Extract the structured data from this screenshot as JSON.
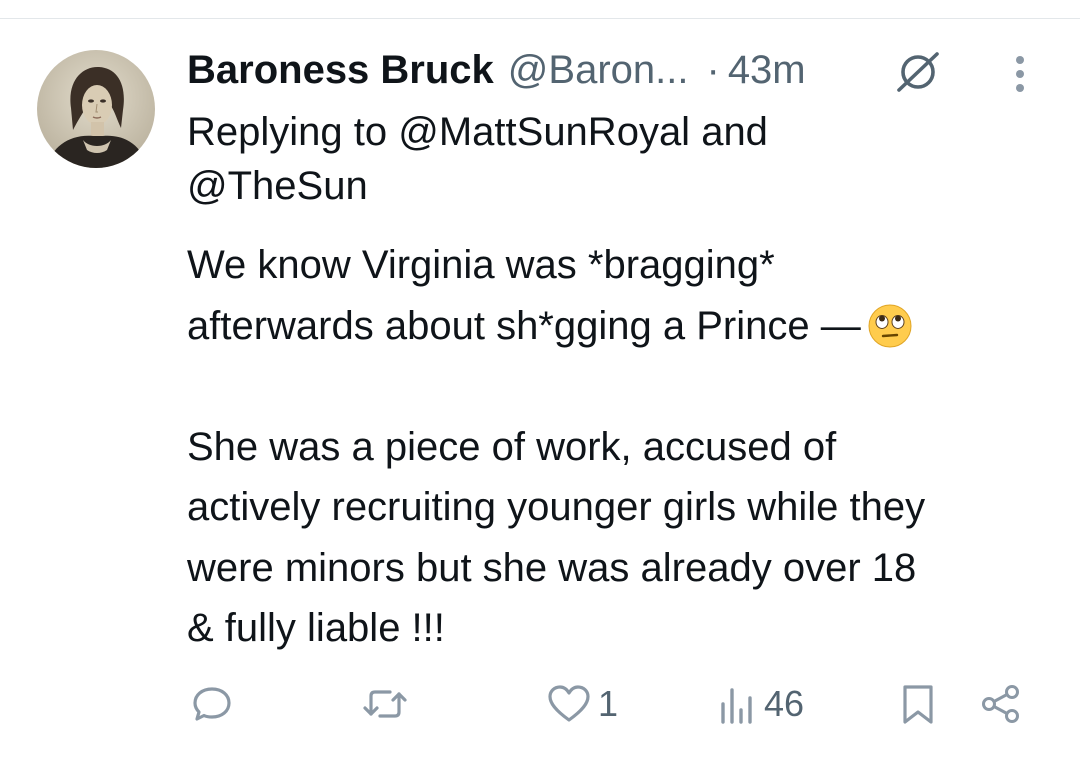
{
  "tweet": {
    "author": {
      "display_name": "Baroness Bruck",
      "handle": "@Baron...",
      "separator": "·",
      "timestamp": "43m",
      "avatar_icon": "portrait-avatar",
      "badge_icon": "no-symbol-icon"
    },
    "reply": {
      "prefix": "Replying to ",
      "mention_1": "@MattSunRoyal",
      "joiner": " and",
      "mention_2": "@TheSun"
    },
    "body": {
      "paragraph_1": "We know Virginia was *bragging*\nafterwards about sh*gging a Prince —",
      "emoji": "face-with-rolling-eyes",
      "paragraph_2": "She was a piece of work, accused of\nactively recruiting younger girls while they\nwere minors but she was already over 18\n& fully liable !!!"
    },
    "actions": {
      "reply_icon": "reply-icon",
      "repost_icon": "repost-icon",
      "like_icon": "heart-icon",
      "like_count": "1",
      "views_icon": "views-icon",
      "views_count": "46",
      "bookmark_icon": "bookmark-icon",
      "share_icon": "share-icon"
    },
    "colors": {
      "text_primary": "#0f1419",
      "text_secondary": "#536471",
      "icon": "#8b98a5",
      "emoji_face": "#ffcc4d"
    }
  }
}
